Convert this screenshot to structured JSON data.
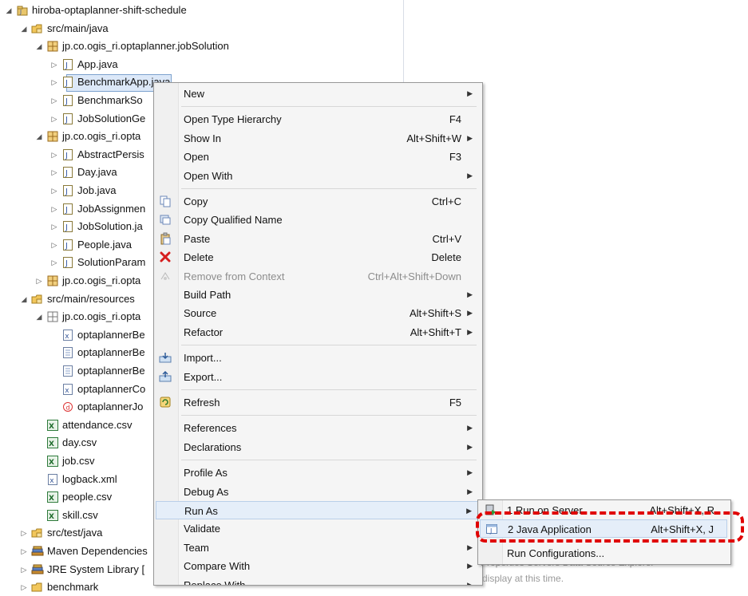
{
  "tree": {
    "items": [
      {
        "label": "hiroba-optaplanner-shift-schedule",
        "icon": "project-icon",
        "twisty": "expanded"
      },
      {
        "label": "src/main/java",
        "icon": "source-folder-icon",
        "twisty": "expanded"
      },
      {
        "label": "jp.co.ogis_ri.optaplanner.jobSolution",
        "icon": "package-icon",
        "twisty": "expanded"
      },
      {
        "label": "App.java",
        "icon": "java-file-icon",
        "twisty": "collapsed"
      },
      {
        "label": "BenchmarkApp.java",
        "icon": "java-file-icon",
        "twisty": "collapsed",
        "selected": true
      },
      {
        "label": "BenchmarkSo",
        "icon": "java-file-icon",
        "twisty": "collapsed"
      },
      {
        "label": "JobSolutionGe",
        "icon": "java-file-icon",
        "twisty": "collapsed"
      },
      {
        "label": "jp.co.ogis_ri.opta",
        "icon": "package-icon",
        "twisty": "expanded"
      },
      {
        "label": "AbstractPersis",
        "icon": "java-file-icon",
        "twisty": "collapsed"
      },
      {
        "label": "Day.java",
        "icon": "java-file-icon",
        "twisty": "collapsed"
      },
      {
        "label": "Job.java",
        "icon": "java-file-icon",
        "twisty": "collapsed"
      },
      {
        "label": "JobAssignmen",
        "icon": "java-file-icon",
        "twisty": "collapsed"
      },
      {
        "label": "JobSolution.ja",
        "icon": "java-file-icon",
        "twisty": "collapsed"
      },
      {
        "label": "People.java",
        "icon": "java-file-icon",
        "twisty": "collapsed"
      },
      {
        "label": "SolutionParam",
        "icon": "java-file-icon",
        "twisty": "collapsed"
      },
      {
        "label": "jp.co.ogis_ri.opta",
        "icon": "package-icon",
        "twisty": "collapsed"
      },
      {
        "label": "src/main/resources",
        "icon": "source-folder-icon",
        "twisty": "expanded"
      },
      {
        "label": "jp.co.ogis_ri.opta",
        "icon": "resource-package-icon",
        "twisty": "expanded"
      },
      {
        "label": "optaplannerBe",
        "icon": "xml-file-icon",
        "twisty": "none"
      },
      {
        "label": "optaplannerBe",
        "icon": "text-file-icon",
        "twisty": "none"
      },
      {
        "label": "optaplannerBe",
        "icon": "text-file-icon",
        "twisty": "none"
      },
      {
        "label": "optaplannerCo",
        "icon": "xml-file-icon",
        "twisty": "none"
      },
      {
        "label": "optaplannerJo",
        "icon": "drools-file-icon",
        "twisty": "none"
      },
      {
        "label": "attendance.csv",
        "icon": "csv-file-icon",
        "twisty": "none"
      },
      {
        "label": "day.csv",
        "icon": "csv-file-icon",
        "twisty": "none"
      },
      {
        "label": "job.csv",
        "icon": "csv-file-icon",
        "twisty": "none"
      },
      {
        "label": "logback.xml",
        "icon": "xml-file-icon",
        "twisty": "none"
      },
      {
        "label": "people.csv",
        "icon": "csv-file-icon",
        "twisty": "none"
      },
      {
        "label": "skill.csv",
        "icon": "csv-file-icon",
        "twisty": "none"
      },
      {
        "label": "src/test/java",
        "icon": "source-folder-icon",
        "twisty": "collapsed"
      },
      {
        "label": "Maven Dependencies",
        "icon": "library-icon",
        "twisty": "collapsed"
      },
      {
        "label": "JRE System Library [",
        "icon": "library-icon",
        "twisty": "collapsed"
      },
      {
        "label": "benchmark",
        "icon": "folder-icon",
        "twisty": "collapsed"
      }
    ]
  },
  "context_menu": {
    "items": [
      {
        "type": "item",
        "label": "New",
        "accel": "",
        "submenu": true
      },
      {
        "type": "sep"
      },
      {
        "type": "item",
        "label": "Open Type Hierarchy",
        "accel": "F4",
        "submenu": false
      },
      {
        "type": "item",
        "label": "Show In",
        "accel": "Alt+Shift+W",
        "submenu": true
      },
      {
        "type": "item",
        "label": "Open",
        "accel": "F3",
        "submenu": false
      },
      {
        "type": "item",
        "label": "Open With",
        "accel": "",
        "submenu": true
      },
      {
        "type": "sep"
      },
      {
        "type": "item",
        "label": "Copy",
        "accel": "Ctrl+C",
        "icon": "copy-icon"
      },
      {
        "type": "item",
        "label": "Copy Qualified Name",
        "accel": "",
        "icon": "copy-qualified-icon"
      },
      {
        "type": "item",
        "label": "Paste",
        "accel": "Ctrl+V",
        "icon": "paste-icon"
      },
      {
        "type": "item",
        "label": "Delete",
        "accel": "Delete",
        "icon": "delete-icon"
      },
      {
        "type": "item",
        "label": "Remove from Context",
        "accel": "Ctrl+Alt+Shift+Down",
        "icon": "remove-context-icon",
        "disabled": true
      },
      {
        "type": "item",
        "label": "Build Path",
        "accel": "",
        "submenu": true
      },
      {
        "type": "item",
        "label": "Source",
        "accel": "Alt+Shift+S",
        "submenu": true
      },
      {
        "type": "item",
        "label": "Refactor",
        "accel": "Alt+Shift+T",
        "submenu": true
      },
      {
        "type": "sep"
      },
      {
        "type": "item",
        "label": "Import...",
        "accel": "",
        "icon": "import-icon"
      },
      {
        "type": "item",
        "label": "Export...",
        "accel": "",
        "icon": "export-icon"
      },
      {
        "type": "sep"
      },
      {
        "type": "item",
        "label": "Refresh",
        "accel": "F5",
        "icon": "refresh-icon"
      },
      {
        "type": "sep"
      },
      {
        "type": "item",
        "label": "References",
        "accel": "",
        "submenu": true
      },
      {
        "type": "item",
        "label": "Declarations",
        "accel": "",
        "submenu": true
      },
      {
        "type": "sep"
      },
      {
        "type": "item",
        "label": "Profile As",
        "accel": "",
        "submenu": true
      },
      {
        "type": "item",
        "label": "Debug As",
        "accel": "",
        "submenu": true
      },
      {
        "type": "item",
        "label": "Run As",
        "accel": "",
        "submenu": true,
        "hover": true
      },
      {
        "type": "item",
        "label": "Validate",
        "accel": ""
      },
      {
        "type": "item",
        "label": "Team",
        "accel": "",
        "submenu": true
      },
      {
        "type": "item",
        "label": "Compare With",
        "accel": "",
        "submenu": true
      },
      {
        "type": "item",
        "label": "Replace With",
        "accel": "",
        "submenu": true
      }
    ]
  },
  "run_as_submenu": {
    "items": [
      {
        "label": "1 Run on Server",
        "accel": "Alt+Shift+X, R",
        "icon": "server-run-icon"
      },
      {
        "label": "2 Java Application",
        "accel": "Alt+Shift+X, J",
        "icon": "java-app-icon",
        "hover": true
      },
      {
        "label": "Run Configurations...",
        "accel": ""
      }
    ]
  },
  "background_view": {
    "tabs_text": "Properties  Servers  Data Source Explorer",
    "status_text": "display at this time."
  },
  "colors": {
    "highlight_ring": "#e00000",
    "hover_bg": "#e5eef9",
    "selection_bg": "#dce8f8"
  }
}
